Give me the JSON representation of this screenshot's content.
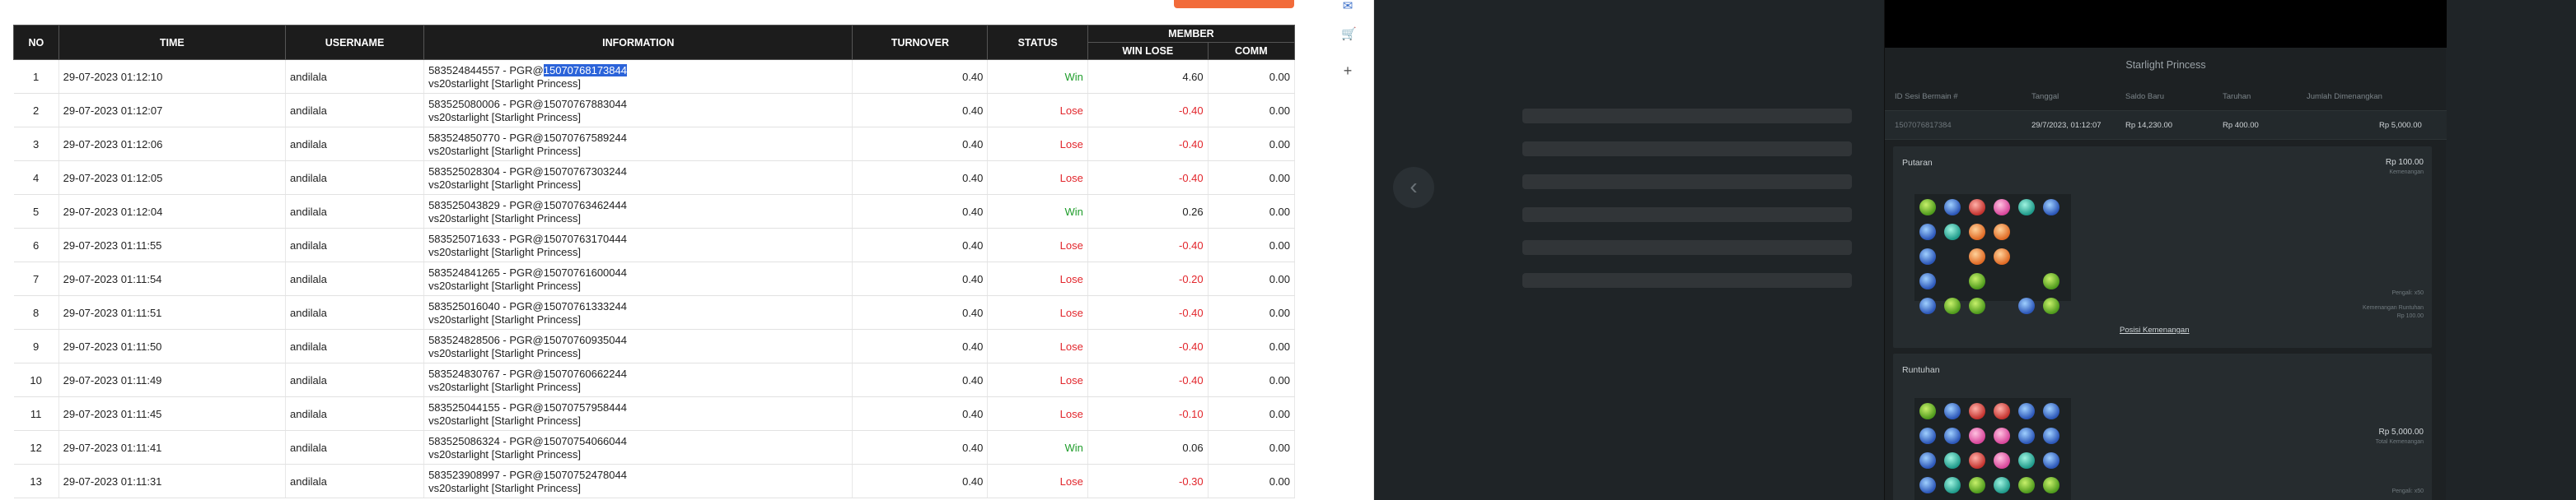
{
  "table": {
    "headers": {
      "no": "NO",
      "time": "TIME",
      "username": "USERNAME",
      "information": "INFORMATION",
      "turnover": "TURNOVER",
      "status": "STATUS",
      "member": "MEMBER",
      "win_lose": "WIN LOSE",
      "comm": "COMM"
    },
    "rows": [
      {
        "no": "1",
        "time": "29-07-2023 01:12:10",
        "username": "andilala",
        "info_pre": "583524844557 - PGR@",
        "info_hl": "15070768173844",
        "info2": "vs20starlight [Starlight Princess]",
        "turnover": "0.40",
        "status": "Win",
        "winlose": "4.60",
        "comm": "0.00"
      },
      {
        "no": "2",
        "time": "29-07-2023 01:12:07",
        "username": "andilala",
        "info_pre": "583525080006 - PGR@15070767883044",
        "info_hl": "",
        "info2": "vs20starlight [Starlight Princess]",
        "turnover": "0.40",
        "status": "Lose",
        "winlose": "-0.40",
        "comm": "0.00"
      },
      {
        "no": "3",
        "time": "29-07-2023 01:12:06",
        "username": "andilala",
        "info_pre": "583524850770 - PGR@15070767589244",
        "info_hl": "",
        "info2": "vs20starlight [Starlight Princess]",
        "turnover": "0.40",
        "status": "Lose",
        "winlose": "-0.40",
        "comm": "0.00"
      },
      {
        "no": "4",
        "time": "29-07-2023 01:12:05",
        "username": "andilala",
        "info_pre": "583525028304 - PGR@15070767303244",
        "info_hl": "",
        "info2": "vs20starlight [Starlight Princess]",
        "turnover": "0.40",
        "status": "Lose",
        "winlose": "-0.40",
        "comm": "0.00"
      },
      {
        "no": "5",
        "time": "29-07-2023 01:12:04",
        "username": "andilala",
        "info_pre": "583525043829 - PGR@15070763462444",
        "info_hl": "",
        "info2": "vs20starlight [Starlight Princess]",
        "turnover": "0.40",
        "status": "Win",
        "winlose": "0.26",
        "comm": "0.00"
      },
      {
        "no": "6",
        "time": "29-07-2023 01:11:55",
        "username": "andilala",
        "info_pre": "583525071633 - PGR@15070763170444",
        "info_hl": "",
        "info2": "vs20starlight [Starlight Princess]",
        "turnover": "0.40",
        "status": "Lose",
        "winlose": "-0.40",
        "comm": "0.00"
      },
      {
        "no": "7",
        "time": "29-07-2023 01:11:54",
        "username": "andilala",
        "info_pre": "583524841265 - PGR@15070761600044",
        "info_hl": "",
        "info2": "vs20starlight [Starlight Princess]",
        "turnover": "0.40",
        "status": "Lose",
        "winlose": "-0.20",
        "comm": "0.00"
      },
      {
        "no": "8",
        "time": "29-07-2023 01:11:51",
        "username": "andilala",
        "info_pre": "583525016040 - PGR@15070761333244",
        "info_hl": "",
        "info2": "vs20starlight [Starlight Princess]",
        "turnover": "0.40",
        "status": "Lose",
        "winlose": "-0.40",
        "comm": "0.00"
      },
      {
        "no": "9",
        "time": "29-07-2023 01:11:50",
        "username": "andilala",
        "info_pre": "583524828506 - PGR@15070760935044",
        "info_hl": "",
        "info2": "vs20starlight [Starlight Princess]",
        "turnover": "0.40",
        "status": "Lose",
        "winlose": "-0.40",
        "comm": "0.00"
      },
      {
        "no": "10",
        "time": "29-07-2023 01:11:49",
        "username": "andilala",
        "info_pre": "583524830767 - PGR@15070760662244",
        "info_hl": "",
        "info2": "vs20starlight [Starlight Princess]",
        "turnover": "0.40",
        "status": "Lose",
        "winlose": "-0.40",
        "comm": "0.00"
      },
      {
        "no": "11",
        "time": "29-07-2023 01:11:45",
        "username": "andilala",
        "info_pre": "583525044155 - PGR@15070757958444",
        "info_hl": "",
        "info2": "vs20starlight [Starlight Princess]",
        "turnover": "0.40",
        "status": "Lose",
        "winlose": "-0.10",
        "comm": "0.00"
      },
      {
        "no": "12",
        "time": "29-07-2023 01:11:41",
        "username": "andilala",
        "info_pre": "583525086324 - PGR@15070754066044",
        "info_hl": "",
        "info2": "vs20starlight [Starlight Princess]",
        "turnover": "0.40",
        "status": "Win",
        "winlose": "0.06",
        "comm": "0.00"
      },
      {
        "no": "13",
        "time": "29-07-2023 01:11:31",
        "username": "andilala",
        "info_pre": "583523908997 - PGR@15070752478044",
        "info_hl": "",
        "info2": "vs20starlight [Starlight Princess]",
        "turnover": "0.40",
        "status": "Lose",
        "winlose": "-0.30",
        "comm": "0.00"
      }
    ]
  },
  "overlay": {
    "back_icon": "chevron-left-icon",
    "game": {
      "title": "Starlight Princess",
      "columns": [
        "ID Sesi Bermain #",
        "Tanggal",
        "Saldo Baru",
        "Taruhan",
        "Jumlah Dimenangkan"
      ],
      "values": [
        "1507076817384",
        "29/7/2023, 01:12:07",
        "Rp 14,230.00",
        "Rp 400.00",
        "Rp 5,000.00"
      ],
      "panel1": {
        "title": "Putaran",
        "amount": "Rp 100.00",
        "amount_sub": "Kemenangan",
        "side_note1": "Pengali: x50",
        "side_note2": "Kemenangan Runtuhan",
        "side_note3": "Rp 100.00",
        "link": "Posisi Kemenangan"
      },
      "panel2": {
        "title": "Runtuhan",
        "amount": "Rp 5,000.00",
        "amount_sub": "Total Kemenangan",
        "side_note": "Pengali: x50"
      }
    }
  },
  "toolbar_icons": [
    "outlook-icon",
    "cart-icon",
    "plus-icon"
  ]
}
